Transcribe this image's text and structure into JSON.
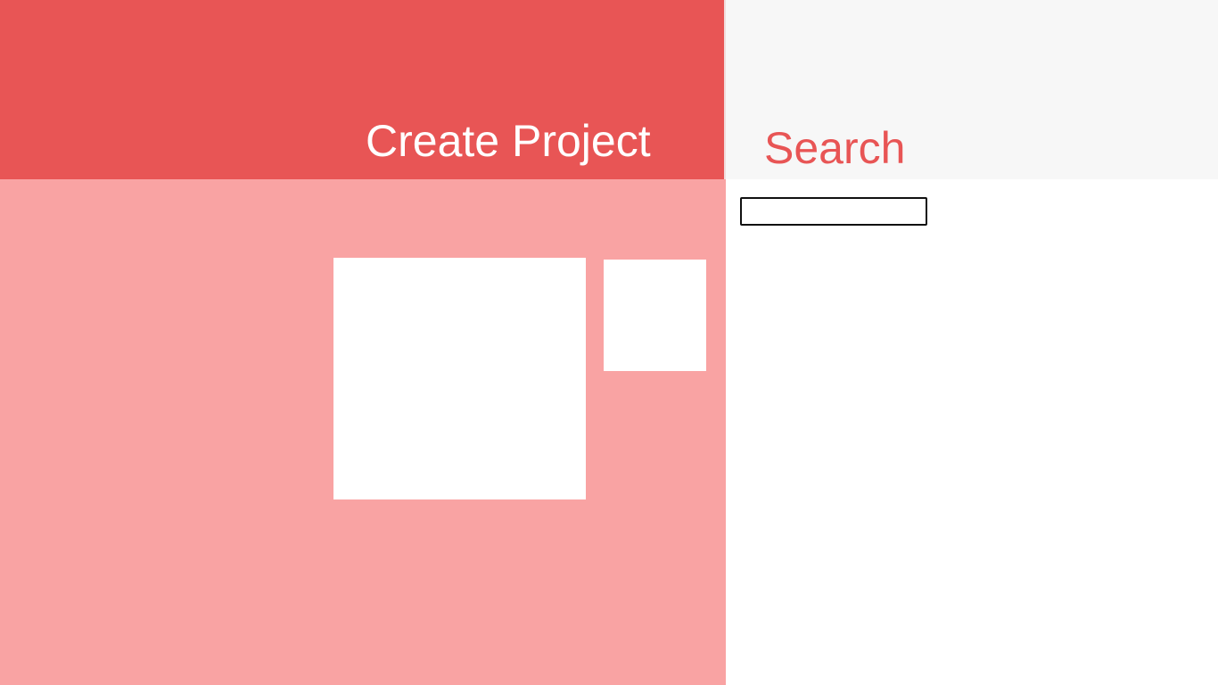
{
  "create_project": {
    "title": "Create Project"
  },
  "search": {
    "title": "Search",
    "input_value": "",
    "input_placeholder": ""
  },
  "colors": {
    "accent": "#e85555",
    "accent_light": "#f9a3a3",
    "panel_header_gray": "#f7f7f7",
    "tile": "#ffffff"
  }
}
